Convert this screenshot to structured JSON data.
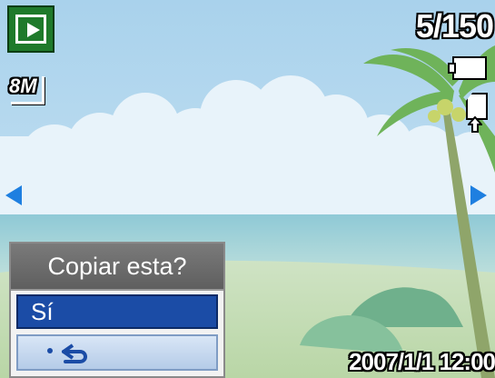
{
  "status": {
    "mode_icon": "playback-icon",
    "image_counter": "5/150",
    "resolution_badge": "8M",
    "battery_icon": "battery-full-icon",
    "storage_icon": "memory-card-icon",
    "datetime": "2007/1/1 12:00"
  },
  "navigation": {
    "prev_icon": "left-arrow-icon",
    "next_icon": "right-arrow-icon",
    "accent_color": "#1e7fe0"
  },
  "dialog": {
    "title": "Copiar esta?",
    "options": [
      {
        "label": "Sí",
        "selected": true
      },
      {
        "label": "",
        "icon": "back-return-icon",
        "selected": false
      }
    ],
    "highlight_color": "#1b4ca6"
  }
}
